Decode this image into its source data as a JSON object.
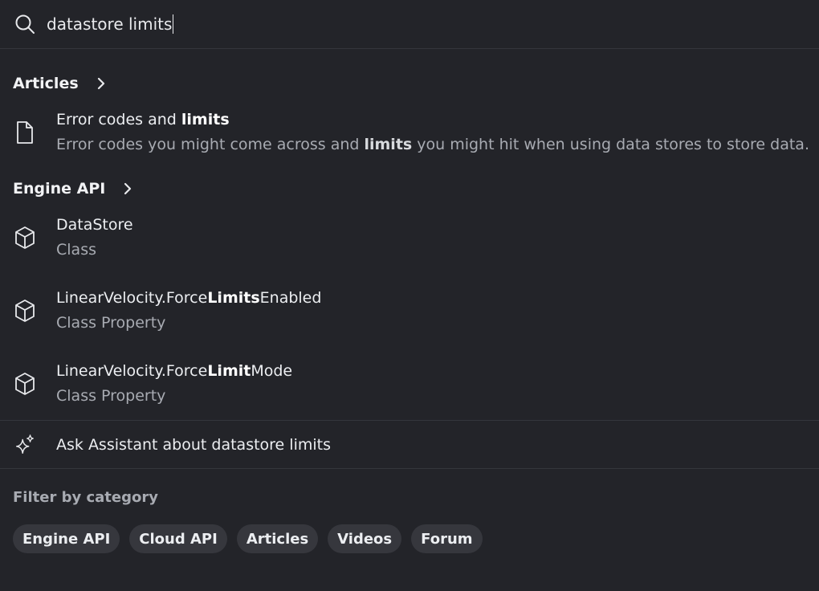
{
  "search": {
    "query": "datastore limits"
  },
  "sections": {
    "articles": {
      "label": "Articles",
      "results": [
        {
          "icon": "document-icon",
          "title_pre": "Error codes and ",
          "title_hl": "limits",
          "sub_pre": "Error codes you might come across and ",
          "sub_hl": "limits",
          "sub_post": " you might hit when using data stores to store data."
        }
      ]
    },
    "engine_api": {
      "label": "Engine API",
      "results": [
        {
          "icon": "cube-icon",
          "title": "DataStore",
          "sub": "Class"
        },
        {
          "icon": "cube-icon",
          "title_pre": "LinearVelocity.Force",
          "title_hl": "Limits",
          "title_post": "Enabled",
          "sub": "Class Property"
        },
        {
          "icon": "cube-icon",
          "title_pre": "LinearVelocity.Force",
          "title_hl": "Limit",
          "title_post": "Mode",
          "sub": "Class Property"
        }
      ]
    }
  },
  "assistant": {
    "icon": "sparkle-icon",
    "label": "Ask Assistant about datastore limits"
  },
  "filter": {
    "title": "Filter by category",
    "chips": [
      "Engine API",
      "Cloud API",
      "Articles",
      "Videos",
      "Forum"
    ]
  }
}
